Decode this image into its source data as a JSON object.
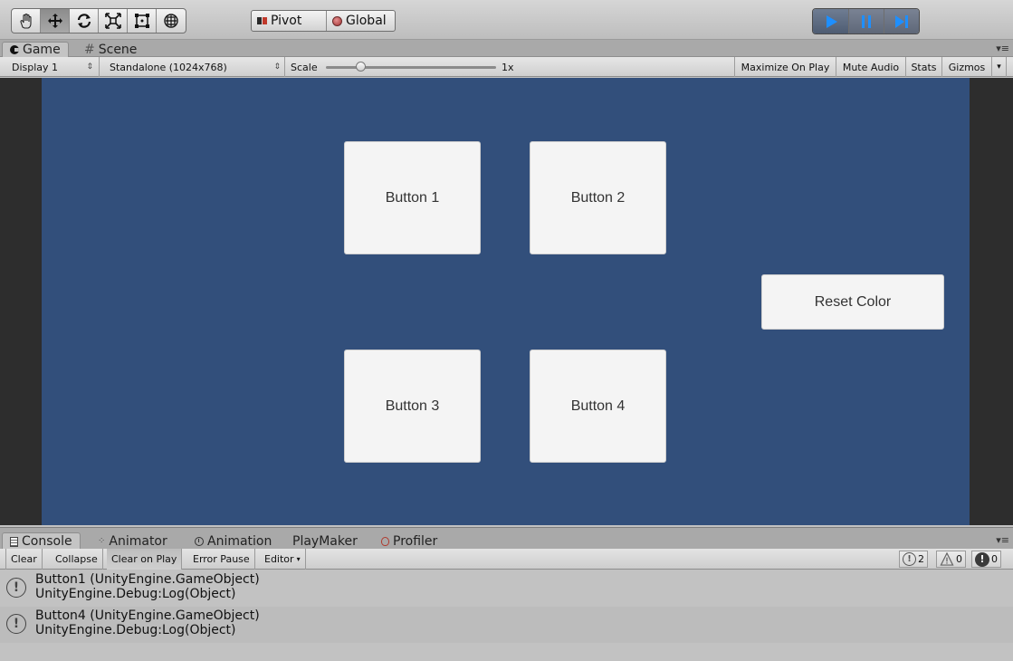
{
  "toolbar": {
    "tools": [
      "hand-tool-icon",
      "move-tool-icon",
      "rotate-tool-icon",
      "scale-tool-icon",
      "rect-tool-icon",
      "transform-tool-icon"
    ],
    "pivot_label": "Pivot",
    "global_label": "Global",
    "playback": [
      "play-icon",
      "pause-icon",
      "step-icon"
    ]
  },
  "game_tabs": {
    "game": "Game",
    "scene": "Scene"
  },
  "game_bar": {
    "display": "Display 1",
    "resolution": "Standalone (1024x768)",
    "scale_label": "Scale",
    "scale_value": "1x",
    "maximize": "Maximize On Play",
    "mute": "Mute Audio",
    "stats": "Stats",
    "gizmos": "Gizmos"
  },
  "viewport": {
    "background": "#324f7b",
    "buttons": [
      "Button 1",
      "Button 2",
      "Button 3",
      "Button 4"
    ],
    "reset_label": "Reset Color"
  },
  "console_tabs": {
    "console": "Console",
    "animator": "Animator",
    "animation": "Animation",
    "playmaker": "PlayMaker",
    "profiler": "Profiler"
  },
  "console_bar": {
    "clear": "Clear",
    "collapse": "Collapse",
    "clear_on_play": "Clear on Play",
    "error_pause": "Error Pause",
    "editor": "Editor",
    "log_count": "2",
    "warning_count": "0",
    "error_count": "0"
  },
  "logs": [
    {
      "line1": "Button1 (UnityEngine.GameObject)",
      "line2": "UnityEngine.Debug:Log(Object)"
    },
    {
      "line1": "Button4 (UnityEngine.GameObject)",
      "line2": "UnityEngine.Debug:Log(Object)"
    }
  ]
}
